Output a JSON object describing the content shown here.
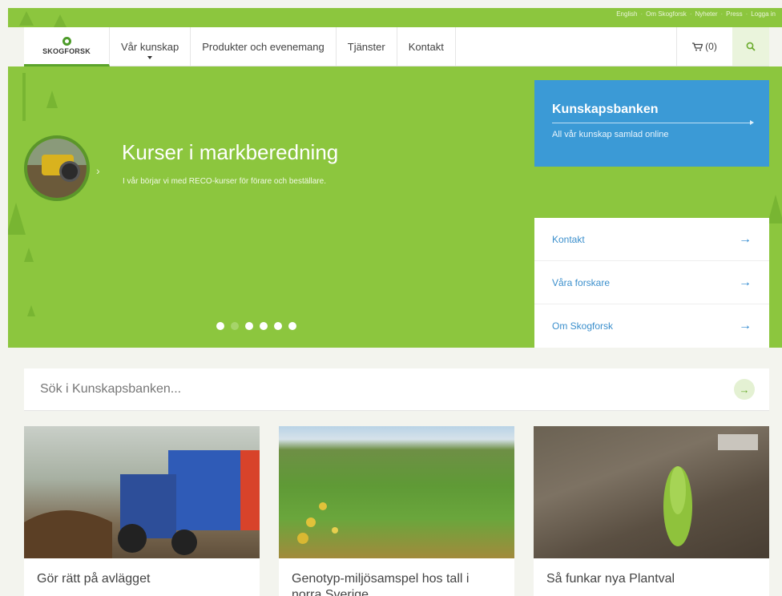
{
  "top_links": [
    "English",
    "Om Skogforsk",
    "Nyheter",
    "Press",
    "Logga in"
  ],
  "nav": {
    "logo_text": "SKOGFORSK",
    "items": [
      "Vår kunskap",
      "Produkter och evenemang",
      "Tjänster",
      "Kontakt"
    ],
    "cart_label": "(0)"
  },
  "hero": {
    "title": "Kurser i markberedning",
    "subtitle": "I vår börjar vi med RECO-kurser för förare och beställare.",
    "slide_count": 6,
    "active_slide": 2
  },
  "kunskapsbanken": {
    "title": "Kunskapsbanken",
    "subtitle": "All vår kunskap samlad online"
  },
  "quick_links": [
    {
      "label": "Kontakt"
    },
    {
      "label": "Våra forskare"
    },
    {
      "label": "Om Skogforsk"
    }
  ],
  "search": {
    "placeholder": "Sök i Kunskapsbanken..."
  },
  "cards": [
    {
      "title": "Gör rätt på avlägget"
    },
    {
      "title": "Genotyp-miljösamspel hos tall i norra Sverige"
    },
    {
      "title": "Så funkar nya Plantval"
    }
  ],
  "colors": {
    "brand_green": "#8cc63e",
    "accent_blue": "#3b9ad6",
    "link_blue": "#3b8fcc"
  },
  "icons": {
    "cart": "cart-icon",
    "search": "search-icon",
    "arrow": "arrow-right-icon"
  }
}
